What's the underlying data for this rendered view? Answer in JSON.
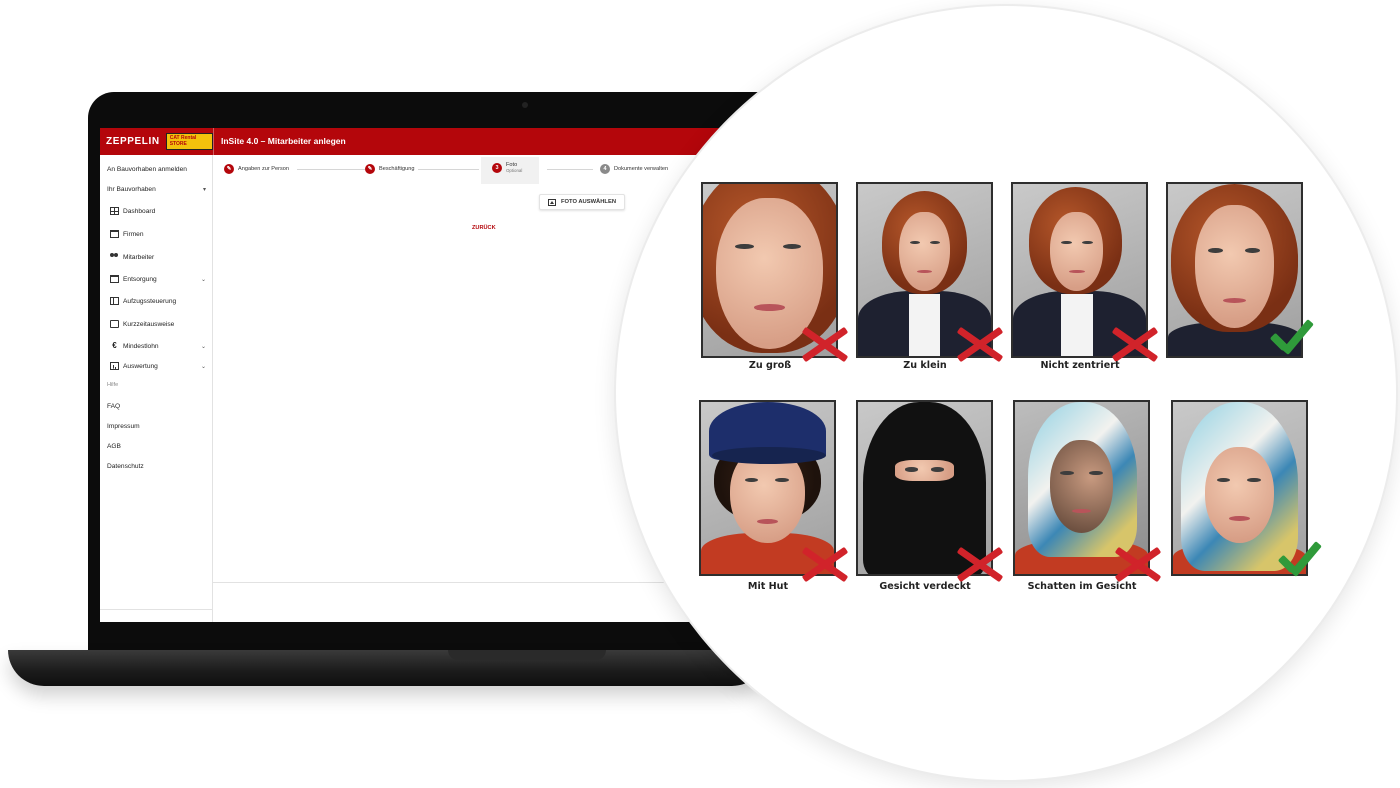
{
  "app": {
    "brand": "ZEPPELIN",
    "badge": "CAT Rental STORE",
    "title": "InSite 4.0 – Mitarbeiter anlegen"
  },
  "sidebar": {
    "items": [
      {
        "label": "An Bauvorhaben anmelden",
        "icon": ""
      },
      {
        "label": "Ihr Bauvorhaben",
        "icon": ""
      },
      {
        "label": "Dashboard",
        "icon": "dashboard-icon"
      },
      {
        "label": "Firmen",
        "icon": "building-icon"
      },
      {
        "label": "Mitarbeiter",
        "icon": "people-icon"
      },
      {
        "label": "Entsorgung",
        "icon": "bin-icon"
      },
      {
        "label": "Aufzugssteuerung",
        "icon": "table-icon"
      },
      {
        "label": "Kurzzeitausweise",
        "icon": "id-card-icon"
      },
      {
        "label": "Mindestlohn",
        "icon": "euro-icon"
      },
      {
        "label": "Auswertung",
        "icon": "chart-icon"
      }
    ],
    "help_label": "Hilfe",
    "links": [
      "FAQ",
      "Impressum",
      "AGB",
      "Datenschutz"
    ]
  },
  "stepper": {
    "steps": [
      {
        "num": "",
        "label": "Angaben zur Person",
        "state": "done"
      },
      {
        "num": "",
        "label": "Beschäftigung",
        "state": "done"
      },
      {
        "num": "3",
        "label": "Foto",
        "sub": "Optional",
        "state": "active"
      },
      {
        "num": "4",
        "label": "Dokumente verwalten",
        "state": "pending"
      }
    ]
  },
  "actions": {
    "photo_button": "FOTO AUSWÄHLEN",
    "back_link": "ZURÜCK"
  },
  "photo_examples": [
    {
      "caption": "Zu groß",
      "valid": false
    },
    {
      "caption": "Zu klein",
      "valid": false
    },
    {
      "caption": "Nicht zentriert",
      "valid": false
    },
    {
      "caption": "",
      "valid": true
    },
    {
      "caption": "Mit Hut",
      "valid": false
    },
    {
      "caption": "Gesicht verdeckt",
      "valid": false
    },
    {
      "caption": "Schatten im Gesicht",
      "valid": false
    },
    {
      "caption": "",
      "valid": true
    }
  ],
  "colors": {
    "brand_red": "#b4060b",
    "reject_red": "#d1232a",
    "accept_green": "#2f9a3a"
  }
}
